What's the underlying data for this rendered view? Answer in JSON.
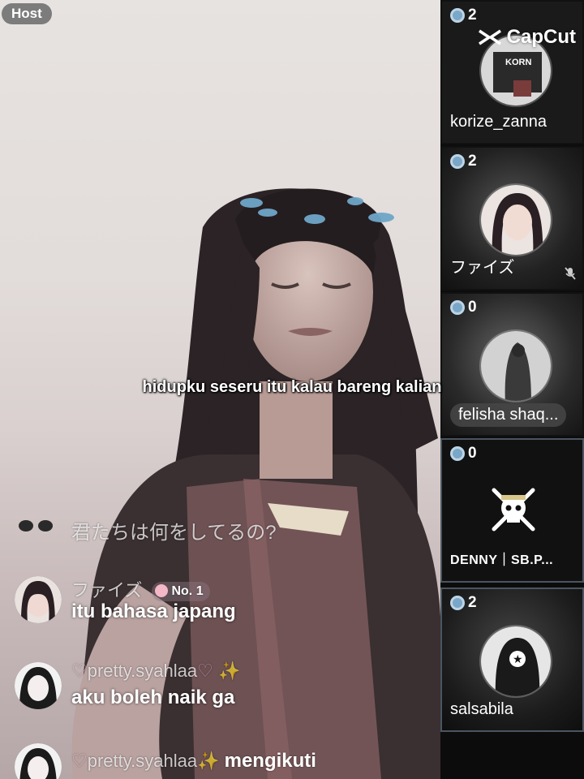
{
  "host_label": "Host",
  "caption": "hidupku seseru itu kalau bareng kalian",
  "watermark": "CapCut",
  "comments": [
    {
      "name": "",
      "text": "君たちは何をしてるの?"
    },
    {
      "name": "ファイズ",
      "badge": "No. 1",
      "text": "itu bahasa japang"
    },
    {
      "name": "pretty.syahlaa",
      "text": "aku boleh naik ga"
    },
    {
      "name": "pretty.syahlaa",
      "text": "mengikuti"
    }
  ],
  "guests": [
    {
      "count": "2",
      "name": "korize_zanna",
      "active": false
    },
    {
      "count": "2",
      "name": "ファイズ",
      "muted": true,
      "active": false
    },
    {
      "count": "0",
      "name": "felisha shaq...",
      "active": false
    },
    {
      "count": "0",
      "name": "DENNY｜SB.P...",
      "active": true
    },
    {
      "count": "2",
      "name": "salsabila",
      "active": true
    }
  ],
  "colors": {
    "panel_bg": "#0c0c0c",
    "count_ring": "#7aa7c7",
    "host_badge": "#5a5a5a"
  },
  "icons": [
    "mic-muted-icon",
    "jolly-roger-icon",
    "capcut-logo-icon",
    "gift-rank-icon"
  ]
}
